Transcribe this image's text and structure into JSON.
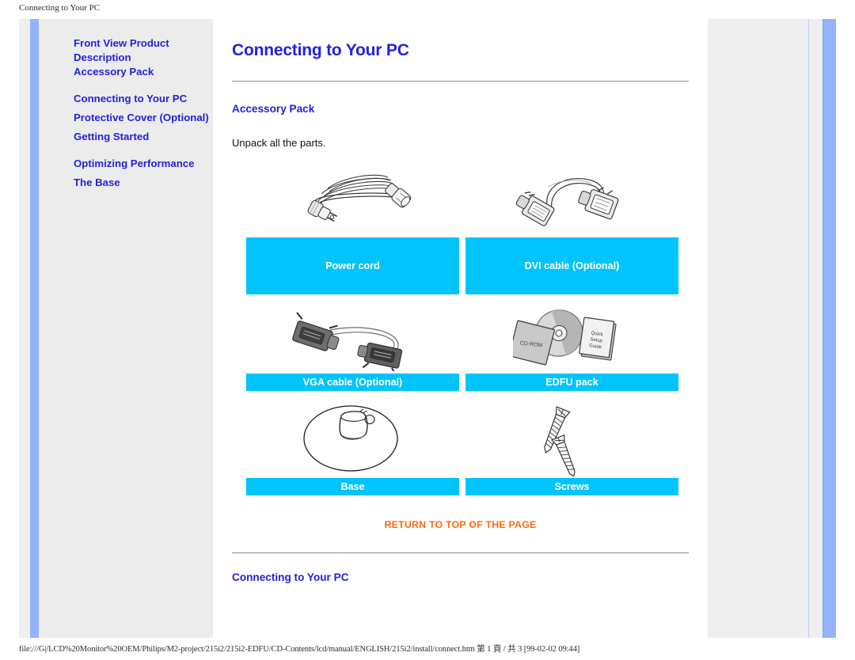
{
  "browser": {
    "header_title": "Connecting to Your PC",
    "footer_path": "file:///G|/LCD%20Monitor%20OEM/Philips/M2-project/215i2/215i2-EDFU/CD-Contents/lcd/manual/ENGLISH/215i2/install/connect.htm 第 1 頁 / 共 3 [99-02-02 09:44]"
  },
  "sidebar": {
    "groups": [
      {
        "items": [
          {
            "label": "Front View Product"
          },
          {
            "label": "Description"
          },
          {
            "label": "Accessory Pack"
          }
        ]
      },
      {
        "items": [
          {
            "label": "Connecting to Your PC"
          },
          {
            "label": "Protective Cover (Optional)"
          },
          {
            "label": "Getting Started"
          }
        ]
      },
      {
        "items": [
          {
            "label": "Optimizing Performance"
          },
          {
            "label": "The Base"
          }
        ]
      }
    ]
  },
  "main": {
    "page_title": "Connecting to Your PC",
    "section_title": "Accessory Pack",
    "intro_text": "Unpack all the parts.",
    "return_to_top": "RETURN TO TOP OF THE PAGE",
    "subsection_title": "Connecting to Your PC",
    "accessories": [
      {
        "caption": "Power cord",
        "icon": "power-cord-illustration"
      },
      {
        "caption": "DVI cable (Optional)",
        "icon": "dvi-cable-illustration"
      },
      {
        "caption": "VGA cable (Optional)",
        "icon": "vga-cable-illustration"
      },
      {
        "caption": "EDFU pack",
        "icon": "edfu-pack-illustration"
      },
      {
        "caption": "Base",
        "icon": "monitor-base-illustration"
      },
      {
        "caption": "Screws",
        "icon": "screws-illustration"
      }
    ],
    "edfu_labels": {
      "disc": "CD-ROM",
      "booklet": "Quick Setup Guide"
    }
  },
  "colors": {
    "link_blue": "#2222dd",
    "caption_cyan": "#00c4fb",
    "return_orange": "#ff6a13",
    "frame_blue": "#93b4fb",
    "sidebar_grey": "#ececed"
  }
}
